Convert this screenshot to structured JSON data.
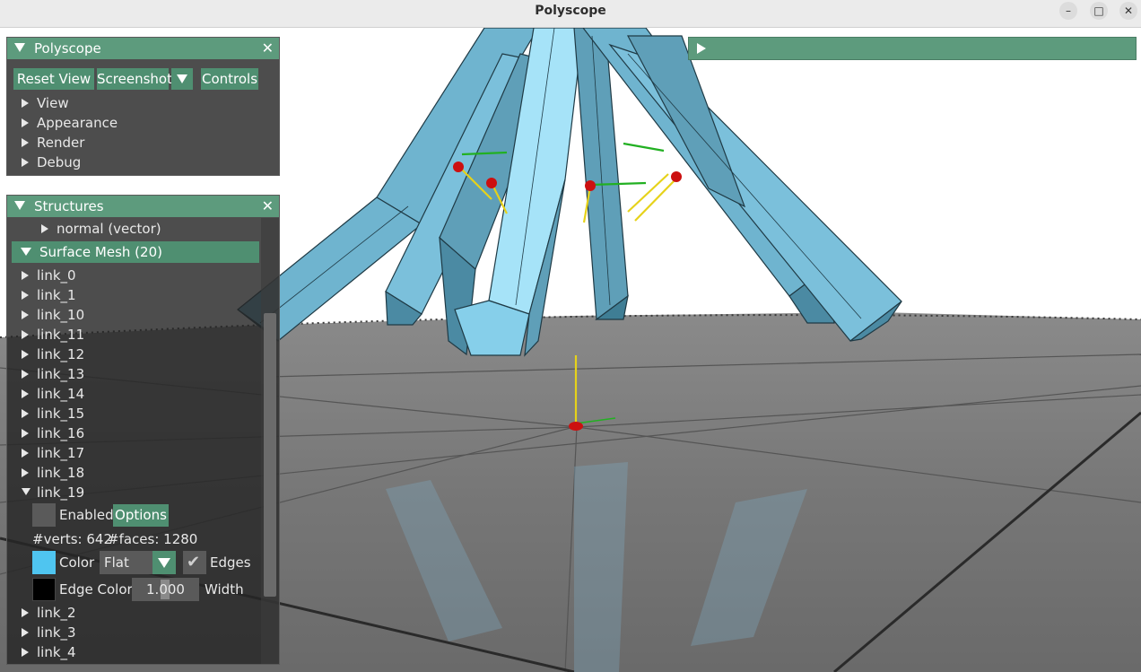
{
  "window": {
    "title": "Polyscope"
  },
  "main_panel": {
    "title": "Polyscope",
    "buttons": {
      "reset_view": "Reset View",
      "screenshot": "Screenshot",
      "controls": "Controls"
    },
    "sections": [
      "View",
      "Appearance",
      "Render",
      "Debug"
    ]
  },
  "structures_panel": {
    "title": "Structures",
    "normal_vector": "normal (vector)",
    "surface_mesh_header": "Surface Mesh (20)",
    "links_before": [
      "link_0",
      "link_1",
      "link_10",
      "link_11",
      "link_12",
      "link_13",
      "link_14",
      "link_15",
      "link_16",
      "link_17",
      "link_18"
    ],
    "expanded_link": {
      "name": "link_19",
      "enabled_label": "Enabled",
      "options_label": "Options",
      "verts_text": "#verts: 642",
      "faces_text": "#faces: 1280",
      "color_label": "Color",
      "color_value": "#4fc5f0",
      "shading_value": "Flat",
      "edges_label": "Edges",
      "edge_color_label": "Edge Color",
      "edge_color_value": "#000000",
      "width_value": "1.000",
      "width_label": "Width"
    },
    "links_after": [
      "link_2",
      "link_3",
      "link_4"
    ]
  },
  "colors": {
    "accent": "#5d9b7d",
    "button": "#4f8f71",
    "mesh": "#8fd3ec",
    "ground": "#6f6f6f"
  }
}
